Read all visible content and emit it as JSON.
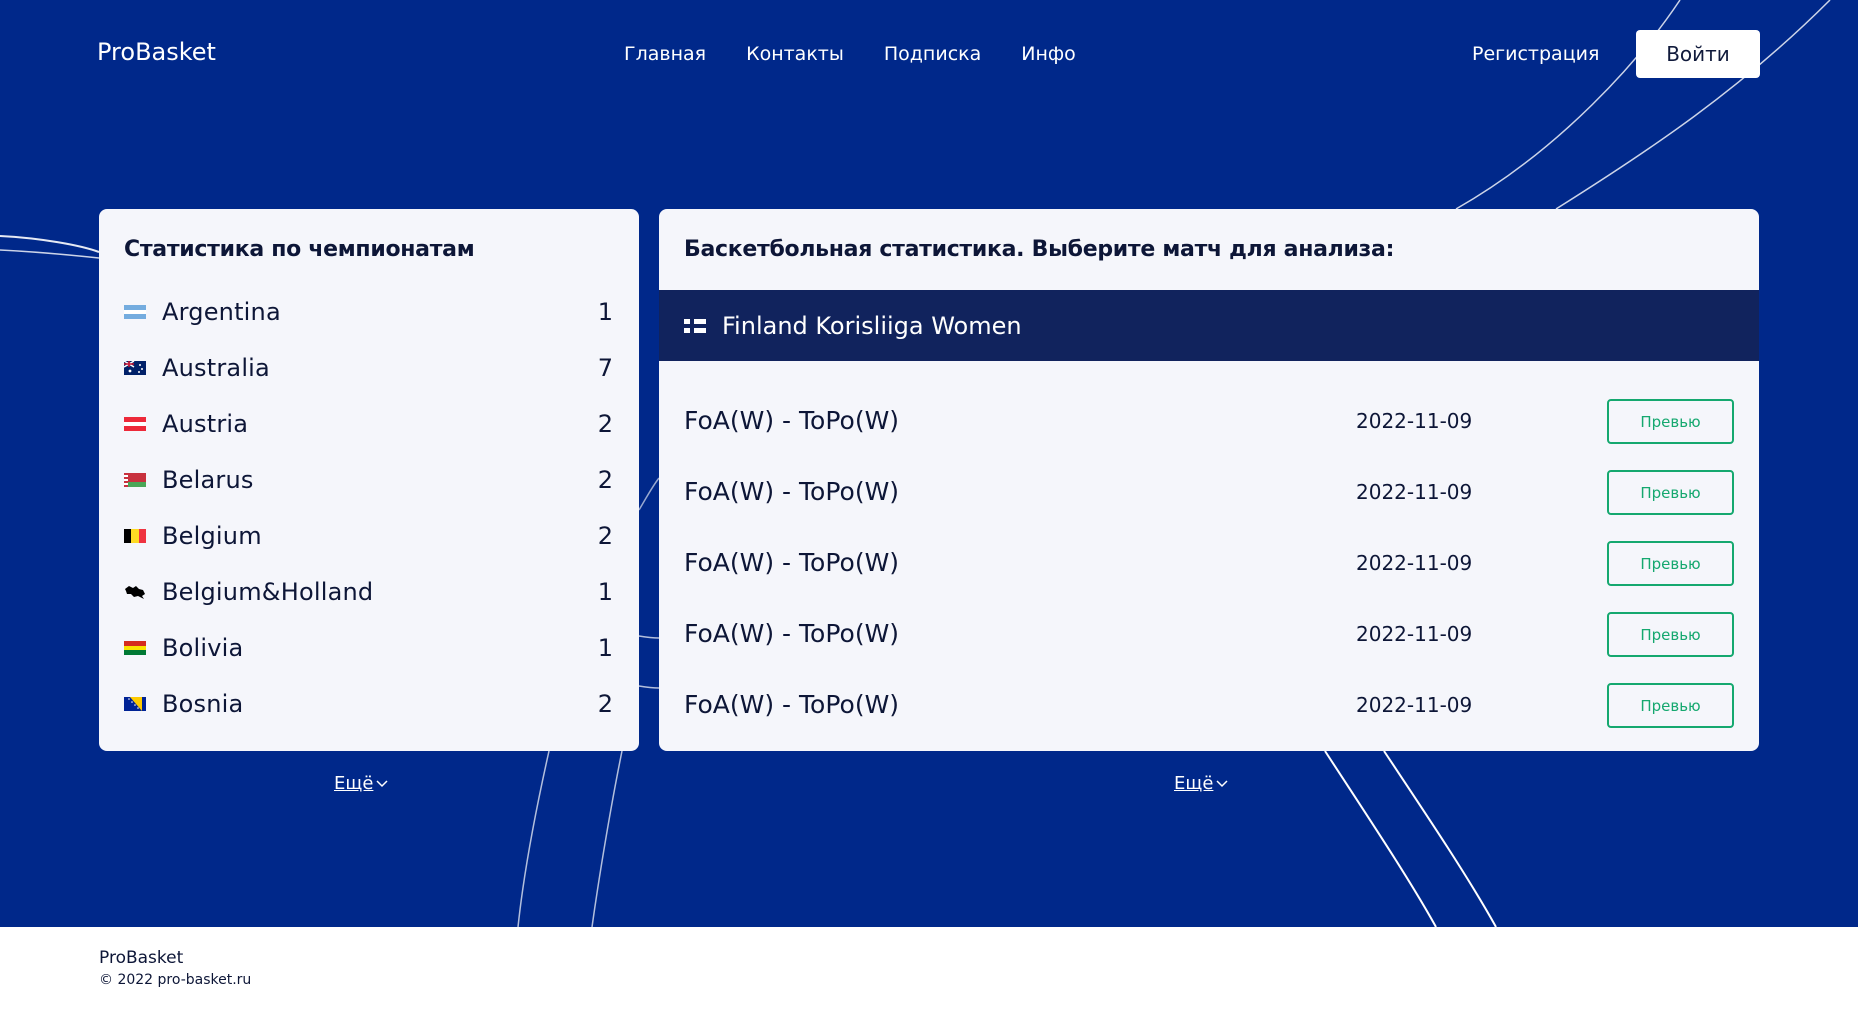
{
  "header": {
    "logo": "ProBasket",
    "nav": [
      "Главная",
      "Контакты",
      "Подписка",
      "Инфо"
    ],
    "register": "Регистрация",
    "login": "Войти"
  },
  "championships": {
    "title": "Статистика по чемпионатам",
    "items": [
      {
        "name": "Argentina",
        "count": "1",
        "flag": "argentina-flag-icon"
      },
      {
        "name": "Australia",
        "count": "7",
        "flag": "australia-flag-icon"
      },
      {
        "name": "Austria",
        "count": "2",
        "flag": "austria-flag-icon"
      },
      {
        "name": "Belarus",
        "count": "2",
        "flag": "belarus-flag-icon"
      },
      {
        "name": "Belgium",
        "count": "2",
        "flag": "belgium-flag-icon"
      },
      {
        "name": "Belgium&Holland",
        "count": "1",
        "flag": "benelux-map-icon"
      },
      {
        "name": "Bolivia",
        "count": "1",
        "flag": "bolivia-flag-icon"
      },
      {
        "name": "Bosnia",
        "count": "2",
        "flag": "bosnia-flag-icon"
      }
    ],
    "more": "Ещё"
  },
  "matches_panel": {
    "title": "Баскетбольная статистика. Выберите матч для анализа:",
    "league": "Finland Korisliiga Women",
    "matches": [
      {
        "name": "FoA(W) - ToPo(W)",
        "date": "2022-11-09",
        "button": "Превью"
      },
      {
        "name": "FoA(W) - ToPo(W)",
        "date": "2022-11-09",
        "button": "Превью"
      },
      {
        "name": "FoA(W) - ToPo(W)",
        "date": "2022-11-09",
        "button": "Превью"
      },
      {
        "name": "FoA(W) - ToPo(W)",
        "date": "2022-11-09",
        "button": "Превью"
      },
      {
        "name": "FoA(W) - ToPo(W)",
        "date": "2022-11-09",
        "button": "Превью"
      }
    ],
    "more": "Ещё"
  },
  "footer": {
    "brand": "ProBasket",
    "copyright": "© 2022 pro-basket.ru"
  },
  "colors": {
    "hero_bg": "#00288a",
    "league_bar": "#11235d",
    "preview_accent": "#15a86f"
  }
}
